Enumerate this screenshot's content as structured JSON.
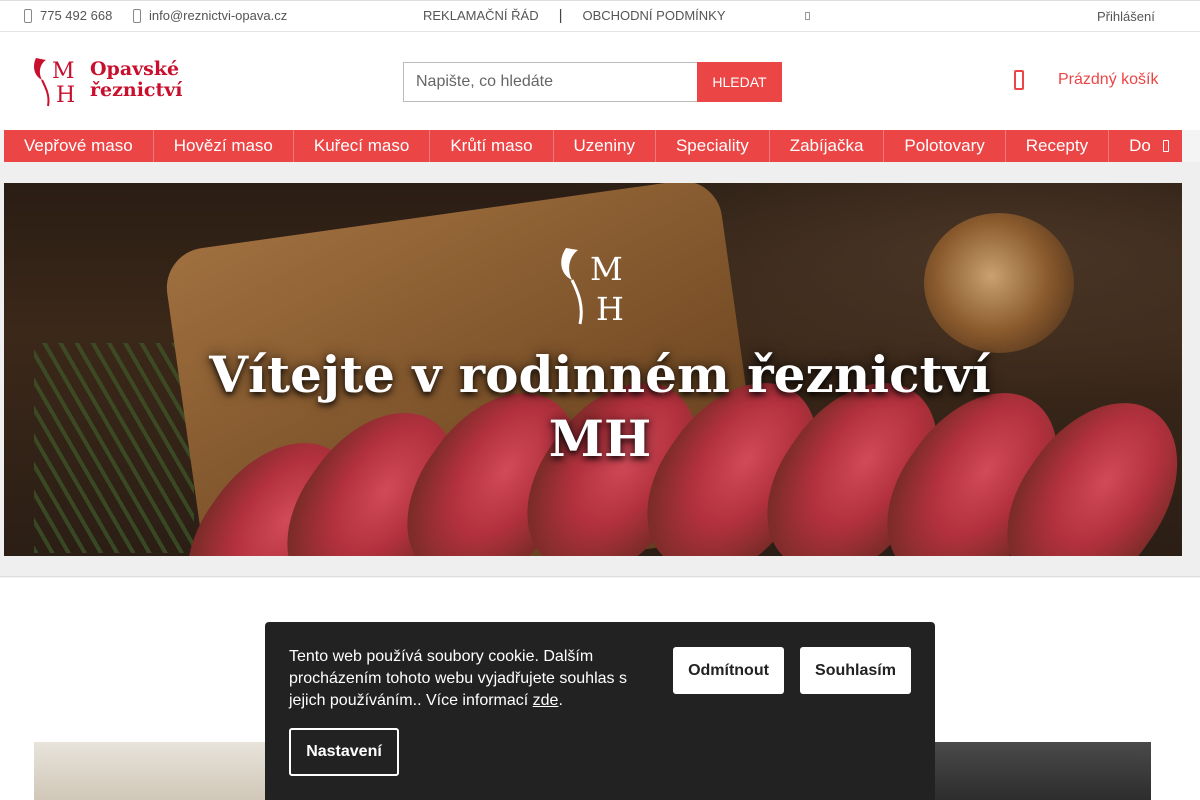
{
  "topbar": {
    "phone": "775 492 668",
    "email": "info@reznictvi-opava.cz",
    "links": [
      "REKLAMAČNÍ ŘÁD",
      "OBCHODNÍ PODMÍNKY"
    ],
    "separator": "|",
    "login": "Přihlášení"
  },
  "header": {
    "logo_line1": "Opavské",
    "logo_line2": "řeznictví",
    "search_placeholder": "Napište, co hledáte",
    "search_button": "HLEDAT",
    "cart_label": "Prázdný košík"
  },
  "nav": {
    "items": [
      "Vepřové maso",
      "Hovězí maso",
      "Kuřecí maso",
      "Krůtí maso",
      "Uzeniny",
      "Speciality",
      "Zabíjačka",
      "Polotovary",
      "Recepty",
      "Do"
    ]
  },
  "banner": {
    "title_line1": "Vítejte v rodinném řeznictví",
    "title_line2": "MH"
  },
  "cookie": {
    "text": "Tento web používá soubory cookie. Dalším procházením tohoto webu vyjadřujete souhlas s jejich používáním.. Více informací ",
    "link": "zde",
    "text_end": ".",
    "reject": "Odmítnout",
    "accept": "Souhlasím",
    "settings": "Nastavení"
  },
  "colors": {
    "accent": "#ec4545",
    "logo_red": "#c8102e",
    "cookie_bg": "#222222"
  },
  "icons": [
    "phone-icon",
    "mail-icon",
    "cart-icon",
    "chevron-right-icon"
  ]
}
